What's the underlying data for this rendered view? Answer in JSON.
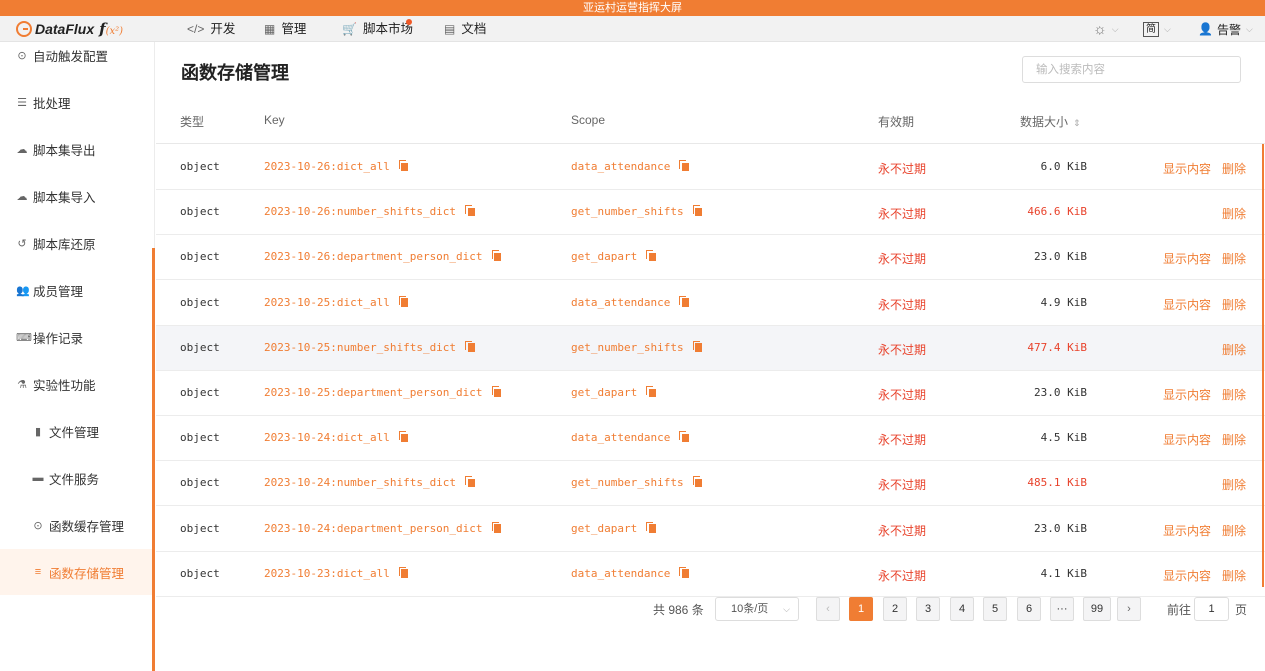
{
  "banner": "亚运村运营指挥大屏",
  "logo": {
    "name": "DataFlux",
    "fx": "f",
    "fx_sup": "(x²)"
  },
  "nav": {
    "items": [
      {
        "label": "开发",
        "icon": "code-icon"
      },
      {
        "label": "管理",
        "icon": "grid-icon"
      },
      {
        "label": "脚本市场",
        "icon": "cart-icon"
      },
      {
        "label": "文档",
        "icon": "book-icon"
      }
    ],
    "theme_icon": "sun-icon",
    "lang": "简",
    "user": "告警"
  },
  "sidebar": {
    "items": [
      {
        "label": "自动触发配置",
        "icon": "clock-icon",
        "glyph": "⊙"
      },
      {
        "label": "批处理",
        "icon": "list-icon",
        "glyph": "☰"
      },
      {
        "label": "脚本集导出",
        "icon": "cloud-upload-icon",
        "glyph": "☁"
      },
      {
        "label": "脚本集导入",
        "icon": "cloud-download-icon",
        "glyph": "☁"
      },
      {
        "label": "脚本库还原",
        "icon": "history-icon",
        "glyph": "↺"
      },
      {
        "label": "成员管理",
        "icon": "users-icon",
        "glyph": "👥"
      },
      {
        "label": "操作记录",
        "icon": "keyboard-icon",
        "glyph": "⌨"
      },
      {
        "label": "实验性功能",
        "icon": "flask-icon",
        "glyph": "⚗"
      },
      {
        "label": "文件管理",
        "icon": "file-icon",
        "glyph": "▮"
      },
      {
        "label": "文件服务",
        "icon": "folder-icon",
        "glyph": "▬"
      },
      {
        "label": "函数缓存管理",
        "icon": "circle-dot-icon",
        "glyph": "⊙"
      },
      {
        "label": "函数存储管理",
        "icon": "database-icon",
        "glyph": "≡"
      }
    ]
  },
  "main": {
    "title": "函数存储管理",
    "search_placeholder": "输入搜索内容",
    "columns": [
      "类型",
      "Key",
      "Scope",
      "有效期",
      "数据大小"
    ],
    "actions": {
      "show": "显示内容",
      "delete": "删除"
    },
    "rows": [
      {
        "type": "object",
        "key": "2023-10-26:dict_all",
        "scope": "data_attendance",
        "expire": "永不过期",
        "size": "6.0 KiB",
        "large": false
      },
      {
        "type": "object",
        "key": "2023-10-26:number_shifts_dict",
        "scope": "get_number_shifts",
        "expire": "永不过期",
        "size": "466.6 KiB",
        "large": true
      },
      {
        "type": "object",
        "key": "2023-10-26:department_person_dict",
        "scope": "get_dapart",
        "expire": "永不过期",
        "size": "23.0 KiB",
        "large": false
      },
      {
        "type": "object",
        "key": "2023-10-25:dict_all",
        "scope": "data_attendance",
        "expire": "永不过期",
        "size": "4.9 KiB",
        "large": false
      },
      {
        "type": "object",
        "key": "2023-10-25:number_shifts_dict",
        "scope": "get_number_shifts",
        "expire": "永不过期",
        "size": "477.4 KiB",
        "large": true
      },
      {
        "type": "object",
        "key": "2023-10-25:department_person_dict",
        "scope": "get_dapart",
        "expire": "永不过期",
        "size": "23.0 KiB",
        "large": false
      },
      {
        "type": "object",
        "key": "2023-10-24:dict_all",
        "scope": "data_attendance",
        "expire": "永不过期",
        "size": "4.5 KiB",
        "large": false
      },
      {
        "type": "object",
        "key": "2023-10-24:number_shifts_dict",
        "scope": "get_number_shifts",
        "expire": "永不过期",
        "size": "485.1 KiB",
        "large": true
      },
      {
        "type": "object",
        "key": "2023-10-24:department_person_dict",
        "scope": "get_dapart",
        "expire": "永不过期",
        "size": "23.0 KiB",
        "large": false
      },
      {
        "type": "object",
        "key": "2023-10-23:dict_all",
        "scope": "data_attendance",
        "expire": "永不过期",
        "size": "4.1 KiB",
        "large": false
      }
    ]
  },
  "pagination": {
    "total": "共 986 条",
    "page_size": "10条/页",
    "pages": [
      "1",
      "2",
      "3",
      "4",
      "5",
      "6",
      "···",
      "99"
    ],
    "prev": "‹",
    "next": "›",
    "goto_label": "前往",
    "goto_value": "1",
    "page_label": "页"
  }
}
